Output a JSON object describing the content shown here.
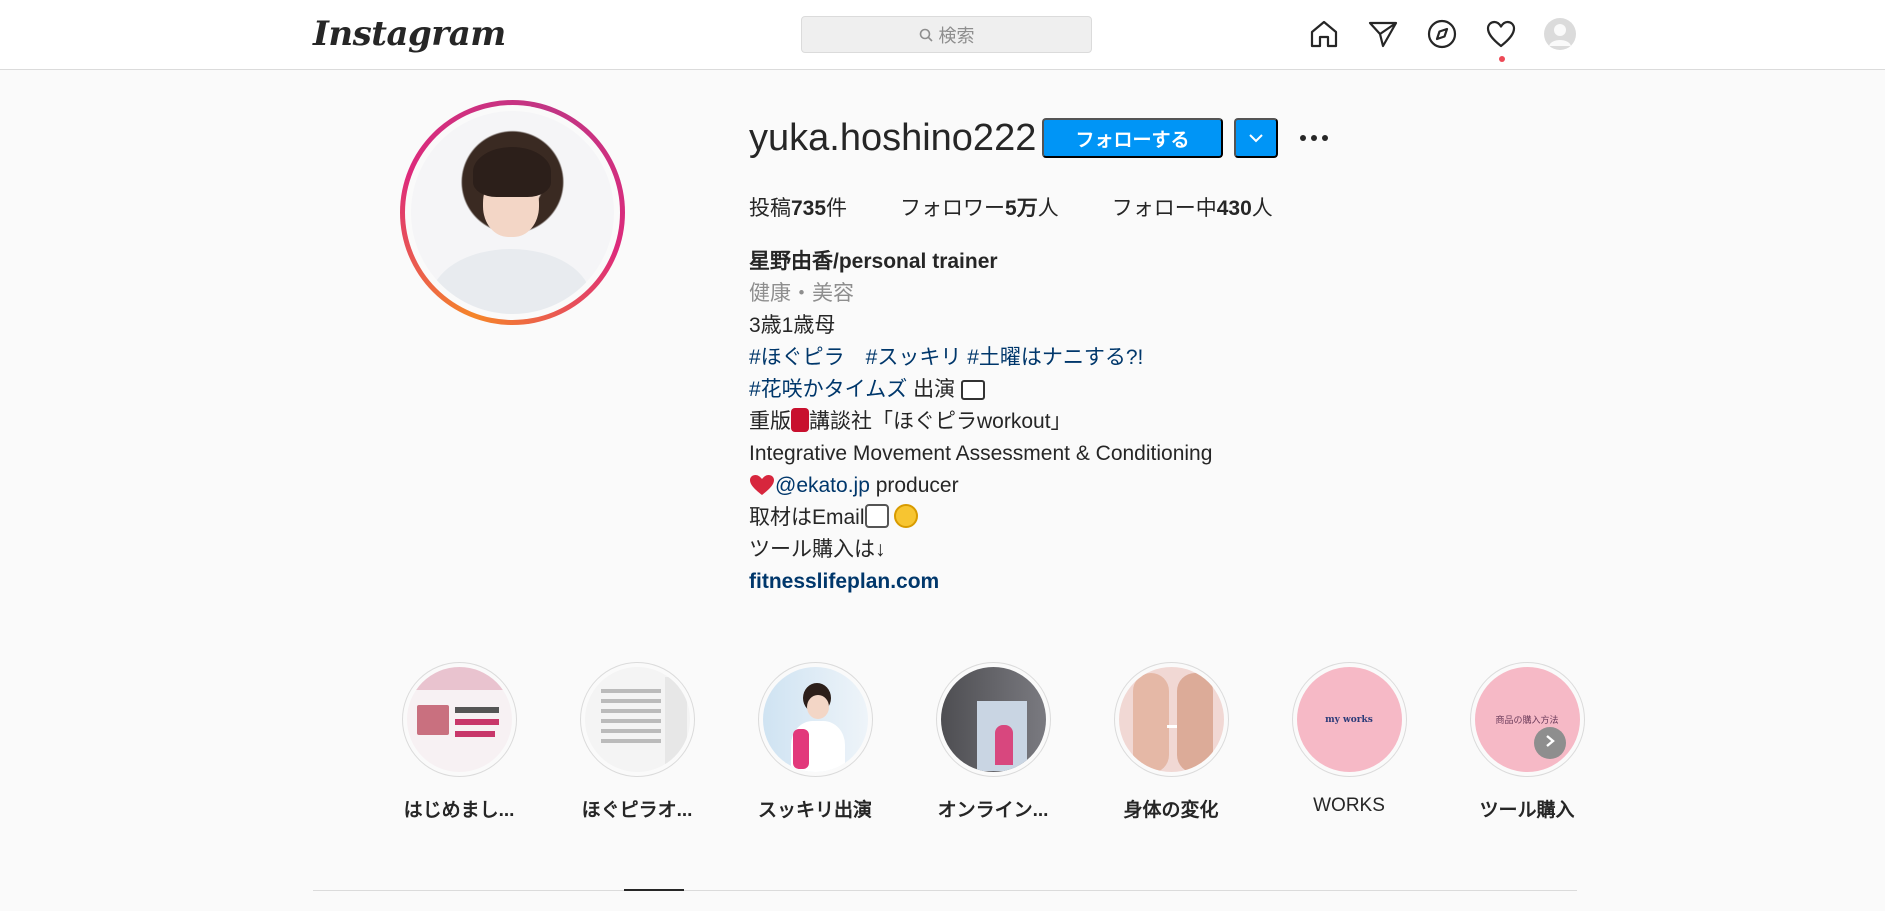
{
  "nav": {
    "logo": "Instagram",
    "search_placeholder": "検索",
    "icons": [
      "home-icon",
      "direct-icon",
      "explore-icon",
      "activity-heart-icon",
      "profile-avatar-icon"
    ]
  },
  "profile": {
    "username": "yuka.hoshino222",
    "follow_label": "フォローする",
    "stats": {
      "posts_prefix": "投稿",
      "posts_value": "735",
      "posts_suffix": "件",
      "followers_prefix": "フォロワー",
      "followers_value": "5万",
      "followers_suffix": "人",
      "following_prefix": "フォロー中",
      "following_value": "430",
      "following_suffix": "人"
    },
    "bio": {
      "name": "星野由香/personal trainer",
      "category": "健康・美容",
      "line1": "3歳1歳母",
      "line2_tags": "#ほぐピラ　#スッキリ #土曜はナニする?!",
      "line3_tag": "#花咲かタイムズ",
      "line3_text": " 出演",
      "line4_a": "重版",
      "line4_b": "講談社「ほぐピラworkout」",
      "line5": "Integrative Movement Assessment & Conditioning",
      "line6_mention": "@ekato.jp",
      "line6_text": " producer",
      "line7": "取材はEmail",
      "line8": "ツール購入は↓",
      "website": "fitnesslifeplan.com"
    }
  },
  "highlights": [
    {
      "label": "はじめまし...",
      "bold": true
    },
    {
      "label": "ほぐピラオ...",
      "bold": true
    },
    {
      "label": "スッキリ出演",
      "bold": true
    },
    {
      "label": "オンライン...",
      "bold": true
    },
    {
      "label": "身体の変化",
      "bold": true
    },
    {
      "label": "WORKS",
      "bold": false,
      "cover_text": "my works"
    },
    {
      "label": "ツール購入",
      "bold": true,
      "cover_text": "商品の購入方法"
    }
  ],
  "colors": {
    "accent": "#0095f6",
    "link": "#00376b",
    "muted": "#8e8e8e",
    "notification": "#ed4956"
  }
}
